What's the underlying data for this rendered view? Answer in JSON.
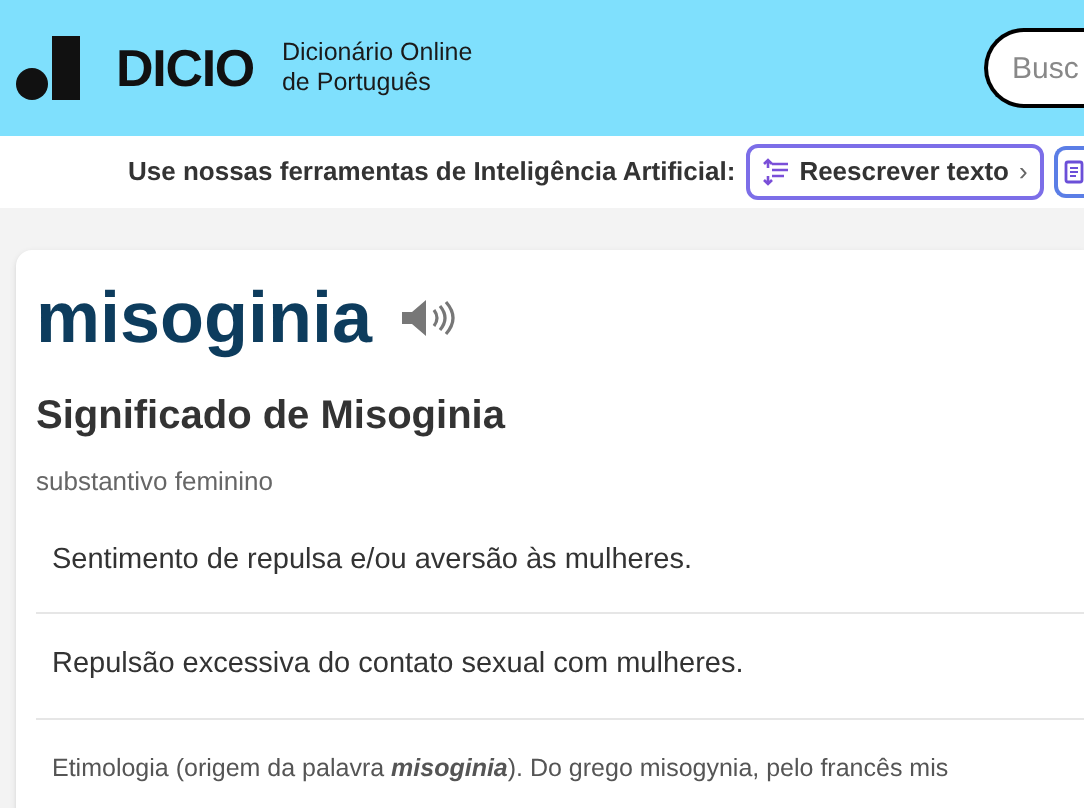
{
  "header": {
    "logo": "DICIO",
    "tagline_lines": [
      "Dicionário Online",
      "de Português"
    ],
    "search": {
      "placeholder": "Busc"
    }
  },
  "ai_bar": {
    "label": "Use nossas ferramentas de Inteligência Artificial:",
    "tools": [
      {
        "label": "Reescrever texto",
        "arrow": "›"
      }
    ]
  },
  "entry": {
    "word": "misoginia",
    "heading": "Significado de Misoginia",
    "class": "substantivo feminino",
    "definitions": [
      {
        "kind": "meaning",
        "text": "Sentimento de repulsa e/ou aversão às mulheres."
      },
      {
        "kind": "meaning",
        "text": "Repulsão excessiva do contato sexual com mulheres."
      },
      {
        "kind": "etymology",
        "text": "Etimologia (origem da palavra *misoginia*). Do grego misogynia, pelo francês mis"
      }
    ]
  }
}
